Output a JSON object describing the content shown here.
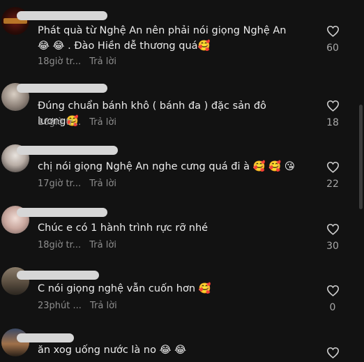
{
  "comments": [
    {
      "text": "Phát quà từ Nghệ An nên phải nói giọng Nghệ An😂 😂 . Đào Hiền dễ thương quá🥰",
      "time": "18giờ tr...",
      "reply": "Trả lời",
      "likes": "60",
      "avatar": "game-logo-avatar"
    },
    {
      "text": "Đúng chuẩn bánh khô ( bánh đa ) đặc sản đô lương🥰",
      "time": "16giờ tr...",
      "reply": "Trả lời",
      "likes": "18",
      "avatar": "person-avatar"
    },
    {
      "text": "chị nói giọng Nghệ An nghe cưng quá đi à 🥰 🥰 😘",
      "time": "17giờ tr...",
      "reply": "Trả lời",
      "likes": "22",
      "avatar": "woman-avatar"
    },
    {
      "text": "Chúc e có 1 hành trình rực rỡ nhé",
      "time": "18giờ tr...",
      "reply": "Trả lời",
      "likes": "30",
      "avatar": "face-avatar"
    },
    {
      "text": "C nói giọng nghệ vẫn cuốn hơn 🥰",
      "time": "23phút ...",
      "reply": "Trả lời",
      "likes": "0",
      "avatar": "outdoor-avatar"
    },
    {
      "text": "ăn xog uống nước là no 😂 😂",
      "time": "",
      "reply": "",
      "likes": "",
      "avatar": "sunset-avatar"
    }
  ],
  "colors": {
    "background": "#121212",
    "text": "#ececec",
    "meta": "#8e8e8e",
    "icon": "#d0d0d0"
  }
}
